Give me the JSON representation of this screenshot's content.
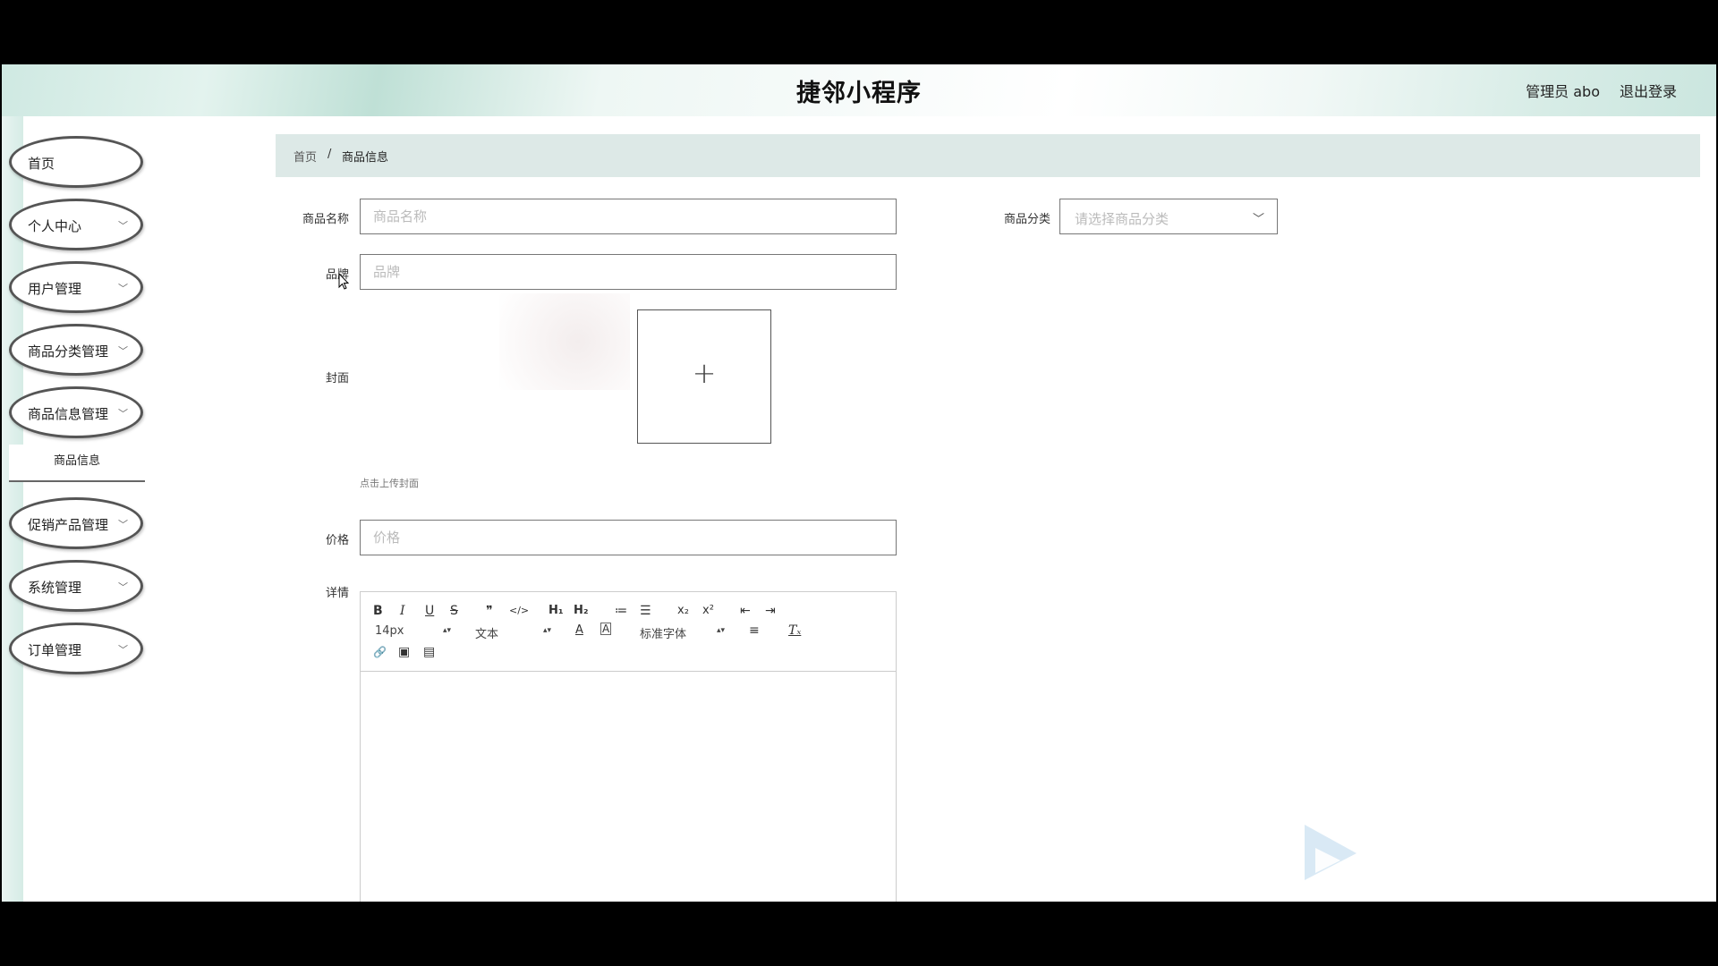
{
  "header": {
    "title": "捷邻小程序",
    "user": "管理员 abo",
    "logout": "退出登录"
  },
  "sidebar": {
    "items": [
      {
        "label": "首页",
        "chevron": false
      },
      {
        "label": "个人中心",
        "chevron": true
      },
      {
        "label": "用户管理",
        "chevron": true
      },
      {
        "label": "商品分类管理",
        "chevron": true
      },
      {
        "label": "商品信息管理",
        "chevron": true
      },
      {
        "label": "促销产品管理",
        "chevron": true
      },
      {
        "label": "系统管理",
        "chevron": true
      },
      {
        "label": "订单管理",
        "chevron": true
      }
    ],
    "submenu": {
      "label": "商品信息"
    }
  },
  "breadcrumb": {
    "home": "首页",
    "separator": "/",
    "current": "商品信息"
  },
  "form": {
    "name": {
      "label": "商品名称",
      "placeholder": "商品名称",
      "value": ""
    },
    "category": {
      "label": "商品分类",
      "placeholder": "请选择商品分类"
    },
    "brand": {
      "label": "品牌",
      "placeholder": "品牌",
      "value": ""
    },
    "cover": {
      "label": "封面",
      "hint": "点击上传封面",
      "plus": "+"
    },
    "price": {
      "label": "价格",
      "placeholder": "价格",
      "value": ""
    },
    "detail": {
      "label": "详情"
    }
  },
  "editor": {
    "font_size": "14px",
    "header_select": "文本",
    "font_family": "标准字体",
    "buttons": {
      "bold": "B",
      "italic": "I",
      "underline": "U",
      "strike": "S",
      "quote": "❞",
      "code": "</>",
      "h1": "H₁",
      "h2": "H₂",
      "ol": "≔",
      "ul": "☰",
      "sub": "x₂",
      "sup": "x²",
      "outdent": "⇤",
      "indent": "⇥",
      "color": "A",
      "background": "A",
      "align": "≡",
      "clean": "Tₓ",
      "link": "🔗",
      "image": "▣",
      "video": "▤"
    }
  },
  "colors": {
    "breadcrumb_bg": "#dde9e7",
    "header_start": "#cfe9e2",
    "sidebar_border": "#555555"
  }
}
